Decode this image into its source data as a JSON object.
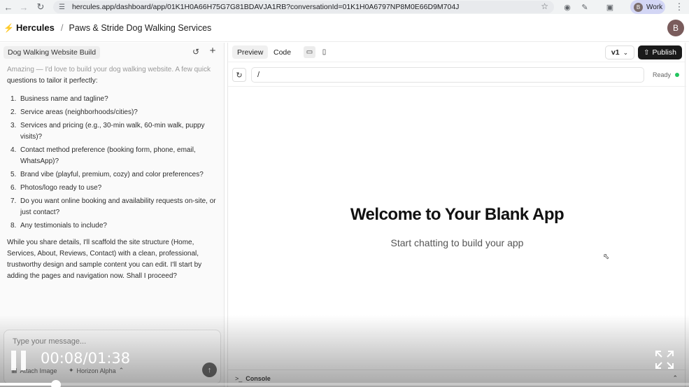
{
  "browser": {
    "url": "hercules.app/dashboard/app/01K1H0A66H75G7G81BDAVJA1RB?conversationId=01K1H0A6797NP8M0E66D9M704J",
    "profile_initial": "B",
    "profile_name": "Work"
  },
  "header": {
    "brand": "Hercules",
    "separator": "/",
    "project": "Paws & Stride Dog Walking Services",
    "user_initial": "B"
  },
  "chat": {
    "title": "Dog Walking Website Build",
    "intro_faded": "Amazing — I'd love to build your dog walking website. A few quick",
    "intro_rest": "questions to tailor it perfectly:",
    "questions": [
      {
        "num": "1.",
        "text": "Business name and tagline?"
      },
      {
        "num": "2.",
        "text": "Service areas (neighborhoods/cities)?"
      },
      {
        "num": "3.",
        "text": "Services and pricing (e.g., 30-min walk, 60-min walk, puppy visits)?"
      },
      {
        "num": "4.",
        "text": "Contact method preference (booking form, phone, email, WhatsApp)?"
      },
      {
        "num": "5.",
        "text": "Brand vibe (playful, premium, cozy) and color preferences?"
      },
      {
        "num": "6.",
        "text": "Photos/logo ready to use?"
      },
      {
        "num": "7.",
        "text": "Do you want online booking and availability requests on-site, or just contact?"
      },
      {
        "num": "8.",
        "text": "Any testimonials to include?"
      }
    ],
    "outro": "While you share details, I'll scaffold the site structure (Home, Services, About, Reviews, Contact) with a clean, professional, trustworthy design and sample content you can edit. I'll start by adding the pages and navigation now. Shall I proceed?",
    "composer": {
      "placeholder": "Type your message...",
      "attach_label": "Attach Image",
      "model_label": "Horizon Alpha"
    }
  },
  "preview": {
    "tabs": [
      "Preview",
      "Code"
    ],
    "version": "v1",
    "publish_label": "Publish",
    "path": "/",
    "status": "Ready",
    "welcome_title": "Welcome to Your Blank App",
    "welcome_subtitle": "Start chatting to build your app",
    "console_label": "Console"
  },
  "video": {
    "time": "00:08/01:38",
    "progress": 0.0816
  },
  "colors": {
    "accent": "#1a1a1a",
    "ready": "#22c55e"
  }
}
